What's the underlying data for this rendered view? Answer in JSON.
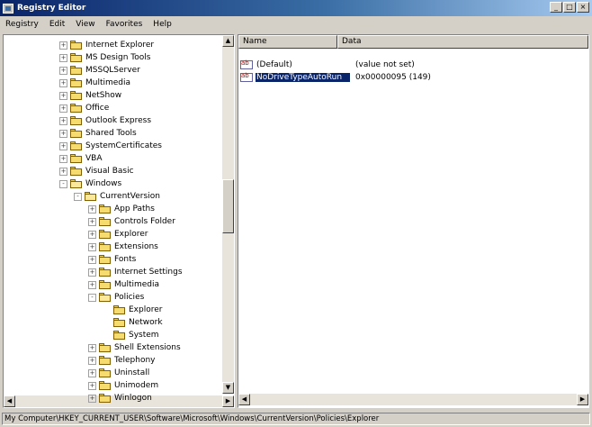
{
  "window": {
    "title": "Registry Editor"
  },
  "menu": [
    {
      "label": "Registry"
    },
    {
      "label": "Edit"
    },
    {
      "label": "View"
    },
    {
      "label": "Favorites"
    },
    {
      "label": "Help"
    }
  ],
  "tree": {
    "items": [
      {
        "label": "Internet Explorer",
        "indent": 1,
        "open": false,
        "expander": "+"
      },
      {
        "label": "MS Design Tools",
        "indent": 1,
        "open": false,
        "expander": "+"
      },
      {
        "label": "MSSQLServer",
        "indent": 1,
        "open": false,
        "expander": "+"
      },
      {
        "label": "Multimedia",
        "indent": 1,
        "open": false,
        "expander": "+"
      },
      {
        "label": "NetShow",
        "indent": 1,
        "open": false,
        "expander": "+"
      },
      {
        "label": "Office",
        "indent": 1,
        "open": false,
        "expander": "+"
      },
      {
        "label": "Outlook Express",
        "indent": 1,
        "open": false,
        "expander": "+"
      },
      {
        "label": "Shared Tools",
        "indent": 1,
        "open": false,
        "expander": "+"
      },
      {
        "label": "SystemCertificates",
        "indent": 1,
        "open": false,
        "expander": "+"
      },
      {
        "label": "VBA",
        "indent": 1,
        "open": false,
        "expander": "+"
      },
      {
        "label": "Visual Basic",
        "indent": 1,
        "open": false,
        "expander": "+"
      },
      {
        "label": "Windows",
        "indent": 1,
        "open": true,
        "expander": "-"
      },
      {
        "label": "CurrentVersion",
        "indent": 2,
        "open": true,
        "expander": "-"
      },
      {
        "label": "App Paths",
        "indent": 3,
        "open": false,
        "expander": "+"
      },
      {
        "label": "Controls Folder",
        "indent": 3,
        "open": false,
        "expander": "+"
      },
      {
        "label": "Explorer",
        "indent": 3,
        "open": false,
        "expander": "+"
      },
      {
        "label": "Extensions",
        "indent": 3,
        "open": false,
        "expander": "+"
      },
      {
        "label": "Fonts",
        "indent": 3,
        "open": false,
        "expander": "+"
      },
      {
        "label": "Internet Settings",
        "indent": 3,
        "open": false,
        "expander": "+"
      },
      {
        "label": "Multimedia",
        "indent": 3,
        "open": false,
        "expander": "+"
      },
      {
        "label": "Policies",
        "indent": 3,
        "open": true,
        "expander": "-"
      },
      {
        "label": "Explorer",
        "indent": 4,
        "open": false,
        "expander": ""
      },
      {
        "label": "Network",
        "indent": 4,
        "open": false,
        "expander": ""
      },
      {
        "label": "System",
        "indent": 4,
        "open": false,
        "expander": ""
      },
      {
        "label": "Shell Extensions",
        "indent": 3,
        "open": false,
        "expander": "+"
      },
      {
        "label": "Telephony",
        "indent": 3,
        "open": false,
        "expander": "+"
      },
      {
        "label": "Uninstall",
        "indent": 3,
        "open": false,
        "expander": "+"
      },
      {
        "label": "Unimodem",
        "indent": 3,
        "open": false,
        "expander": "+"
      },
      {
        "label": "Winlogon",
        "indent": 3,
        "open": false,
        "expander": "+"
      }
    ]
  },
  "list": {
    "headers": [
      {
        "label": "Name"
      },
      {
        "label": "Data"
      }
    ],
    "rows": [
      {
        "name": "(Default)",
        "data": "(value not set)",
        "selected": false
      },
      {
        "name": "NoDriveTypeAutoRun",
        "data": "0x00000095 (149)",
        "selected": true
      }
    ]
  },
  "status": {
    "path": "My Computer\\HKEY_CURRENT_USER\\Software\\Microsoft\\Windows\\CurrentVersion\\Policies\\Explorer"
  },
  "icons": {
    "folder": "folder-icon",
    "value": "reg-sz-icon",
    "close": "close-icon",
    "minimize": "minimize-icon",
    "maximize": "maximize-icon"
  },
  "colors": {
    "titlebar_start": "#0a246a",
    "titlebar_end": "#a6caf0",
    "selection": "#0a246a",
    "chrome": "#d4d0c8"
  }
}
